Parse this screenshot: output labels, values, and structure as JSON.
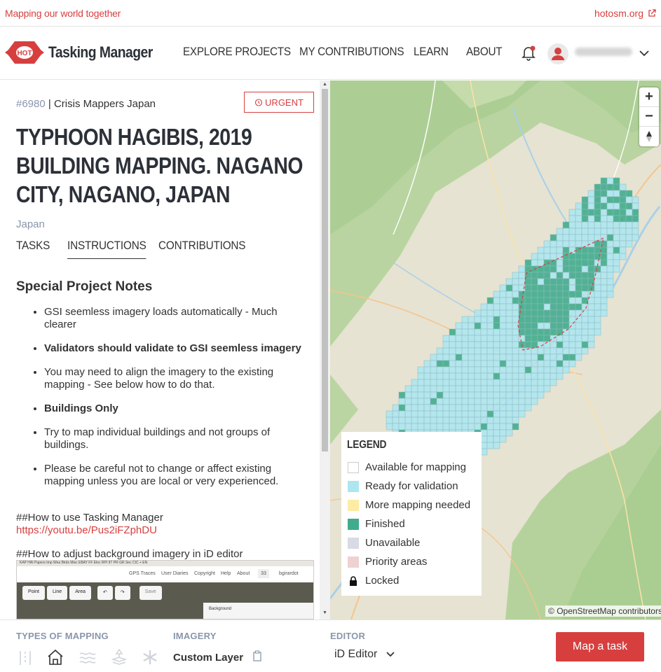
{
  "topbar": {
    "tagline": "Mapping our world together",
    "site_link": "hotosm.org"
  },
  "nav": {
    "logo_text": "HOT",
    "brand": "Tasking Manager",
    "items": [
      "EXPLORE PROJECTS",
      "MY CONTRIBUTIONS",
      "LEARN",
      "ABOUT"
    ]
  },
  "project": {
    "id": "#6980",
    "org": " | Crisis Mappers Japan",
    "badge": "URGENT",
    "title": "TYPHOON HAGIBIS, 2019 BUILDING MAPPING. NAGANO CITY, NAGANO, JAPAN",
    "country": "Japan",
    "tabs": [
      "TASKS",
      "INSTRUCTIONS",
      "CONTRIBUTIONS"
    ],
    "active_tab": "INSTRUCTIONS"
  },
  "instructions": {
    "heading": "Special Project Notes",
    "items": [
      "GSI seemless imagery loads automatically - Much clearer",
      "Validators should validate to GSI seemless imagery",
      "You may need to align the imagery to the existing mapping - See below how to do that.",
      "Buildings Only",
      "Try to map individual buildings and not groups of buildings.",
      "Please be careful not to change or affect existing mapping unless you are local or very experienced."
    ],
    "howto_tm": "##How to use Tasking Manager",
    "howto_tm_link": "https://youtu.be/Pus2iFZphDU",
    "howto_id": "##How to adjust background imagery in iD editor",
    "shot_bookmarks": "KAP  HAI  Papers  tmp  Wea  Birds  Misc  EBAY  FF  Elec  RPI  IIT  PR  GR  Sec  CIC + EN",
    "shot_links": [
      "GPS Traces",
      "User Diaries",
      "Copyright",
      "Help",
      "About"
    ],
    "shot_badge": "33",
    "shot_user": "bgirardot",
    "shot_tools": [
      "Point",
      "Line",
      "Area"
    ],
    "shot_save": "Save",
    "shot_panel": "Background"
  },
  "map": {
    "legend_title": "LEGEND",
    "legend": [
      {
        "label": "Available for mapping",
        "color": "#ffffff",
        "border": "#cccccc"
      },
      {
        "label": "Ready for validation",
        "color": "#ade6ef",
        "border": "#ade6ef"
      },
      {
        "label": "More mapping needed",
        "color": "#fceca4",
        "border": "#fceca4"
      },
      {
        "label": "Finished",
        "color": "#40ac8c",
        "border": "#40ac8c"
      },
      {
        "label": "Unavailable",
        "color": "#d8dae4",
        "border": "#d8dae4"
      },
      {
        "label": "Priority areas",
        "color": "#efd1d1",
        "border": "#efd1d1"
      },
      {
        "label": "Locked",
        "color": "lock",
        "border": "none"
      }
    ],
    "zoom_in": "+",
    "zoom_out": "−",
    "compass": "⇅",
    "attribution_prefix": "©",
    "attribution_link": "OpenStreetMap",
    "attribution_suffix": "contributors"
  },
  "footer": {
    "types_label": "TYPES OF MAPPING",
    "imagery_label": "IMAGERY",
    "imagery_value": "Custom Layer",
    "editor_label": "EDITOR",
    "editor_value": "iD Editor",
    "cta": "Map a task"
  },
  "colors": {
    "brand_red": "#d73f3f",
    "muted": "#8a96aa",
    "finished": "#40ac8c",
    "ready": "#ade6ef"
  }
}
